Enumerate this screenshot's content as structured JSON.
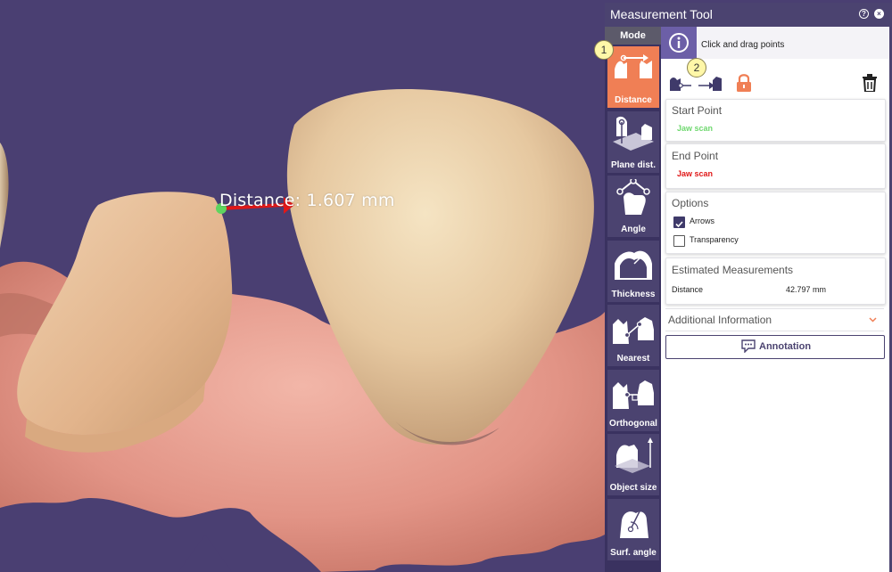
{
  "viewport": {
    "measurement_label": "Distance: 1.607 mm"
  },
  "window": {
    "title": "Measurement Tool",
    "help_icon": "question-icon",
    "close_icon": "close-icon"
  },
  "mode_panel": {
    "heading": "Mode",
    "modes": [
      {
        "label": "Distance",
        "icon": "distance-icon",
        "active": true
      },
      {
        "label": "Plane dist.",
        "icon": "plane-distance-icon",
        "active": false
      },
      {
        "label": "Angle",
        "icon": "angle-icon",
        "active": false
      },
      {
        "label": "Thickness",
        "icon": "thickness-icon",
        "active": false
      },
      {
        "label": "Nearest",
        "icon": "nearest-icon",
        "active": false
      },
      {
        "label": "Orthogonal",
        "icon": "orthogonal-icon",
        "active": false
      },
      {
        "label": "Object size",
        "icon": "object-size-icon",
        "active": false
      },
      {
        "label": "Surf. angle",
        "icon": "surface-angle-icon",
        "active": false
      }
    ]
  },
  "info": {
    "text": "Click and drag points",
    "icon": "info-icon"
  },
  "toolbar": {
    "icons": [
      "point-to-point-icon",
      "lock-icon",
      "trash-icon"
    ]
  },
  "start_point": {
    "heading": "Start Point",
    "value": "Jaw scan",
    "color": "#6fd86f"
  },
  "end_point": {
    "heading": "End Point",
    "value": "Jaw scan",
    "color": "#e01818"
  },
  "options": {
    "heading": "Options",
    "items": [
      {
        "label": "Arrows",
        "checked": true
      },
      {
        "label": "Transparency",
        "checked": false
      }
    ]
  },
  "estimated": {
    "heading": "Estimated Measurements",
    "rows": [
      {
        "label": "Distance",
        "value": "42.797 mm"
      }
    ]
  },
  "additional": {
    "label": "Additional Information",
    "icon": "chevron-down-icon"
  },
  "annotation_button": {
    "label": "Annotation",
    "icon": "comment-icon"
  },
  "callouts": [
    "1",
    "2"
  ],
  "colors": {
    "background": "#4a3f72",
    "accent": "#f07f55",
    "panel_purple": "#4b4370",
    "info_purple": "#6c5fa7"
  }
}
